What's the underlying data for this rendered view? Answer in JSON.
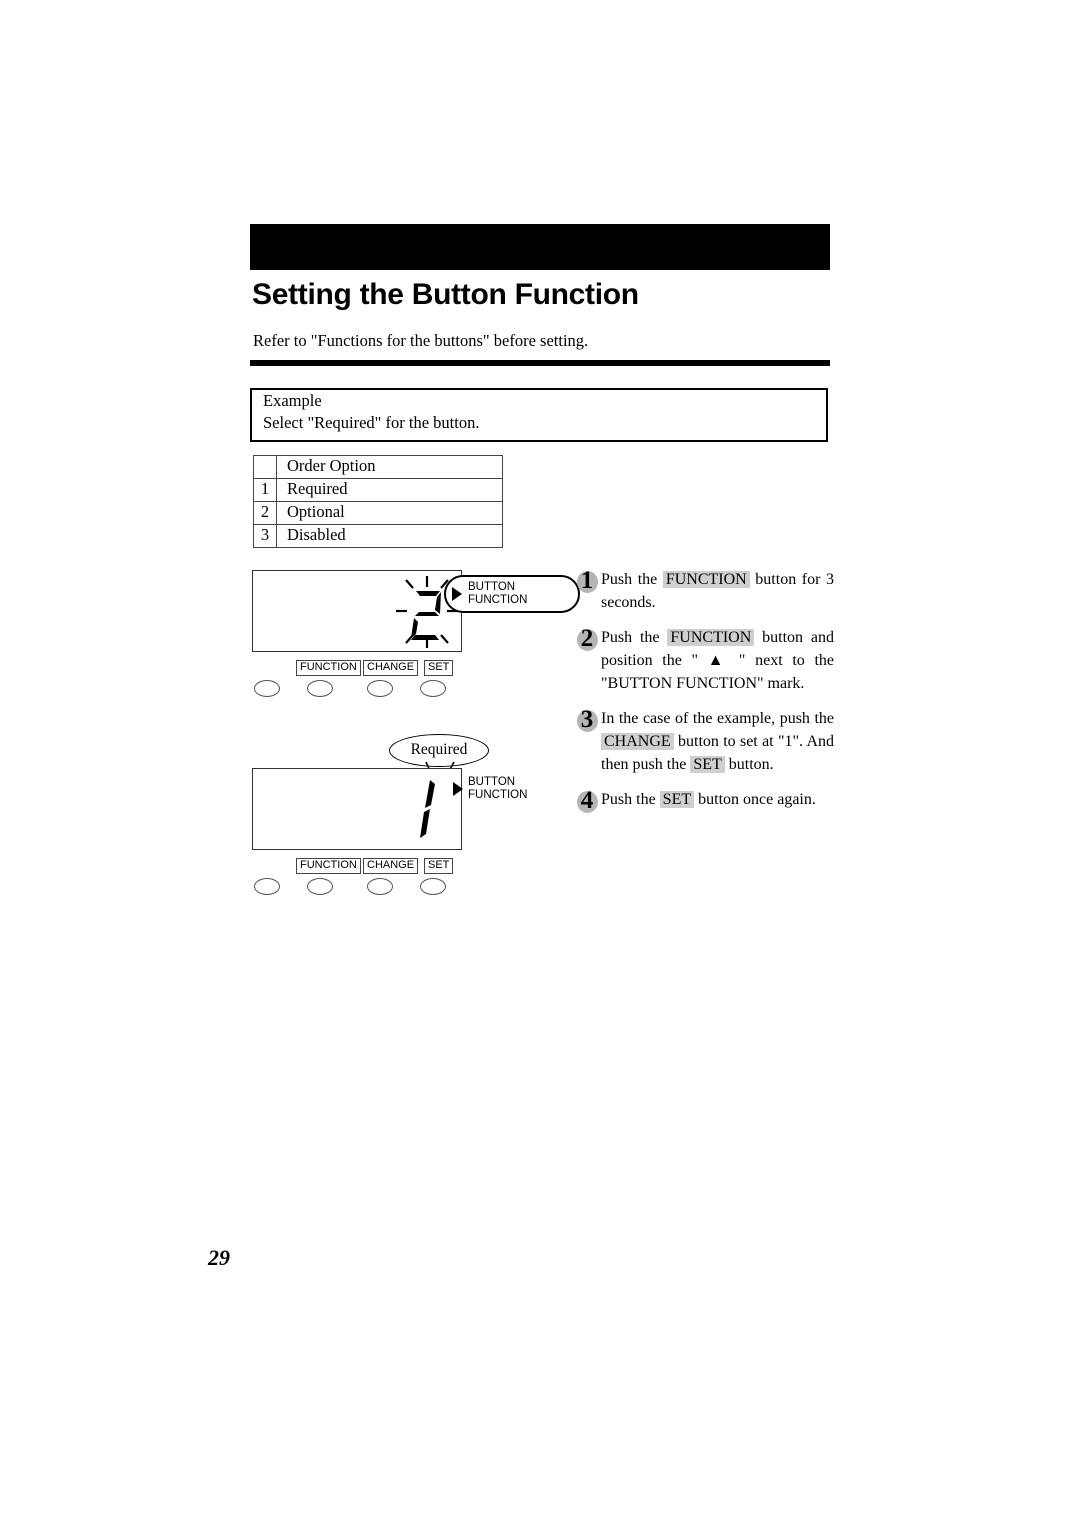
{
  "header": {
    "title": "Setting the Button Function",
    "intro": "Refer to \"Functions for the buttons\" before setting."
  },
  "example": {
    "label": "Example",
    "sentence": "Select \"Required\" for the button."
  },
  "option_table": {
    "columns": [
      "",
      "Order Option"
    ],
    "rows": [
      {
        "num": "1",
        "option": "Required"
      },
      {
        "num": "2",
        "option": "Optional"
      },
      {
        "num": "3",
        "option": "Disabled"
      }
    ]
  },
  "devices": [
    {
      "name": "device-panel-step2",
      "display_digit": "2",
      "display_blinking": true,
      "marker_label_line1": "BUTTON",
      "marker_label_line2": "FUNCTION",
      "marker_highlighted": true,
      "buttons": [
        "FUNCTION",
        "CHANGE",
        "SET"
      ]
    },
    {
      "name": "device-panel-step3",
      "display_digit": "1",
      "display_blinking": false,
      "callout": "Required",
      "marker_label_line1": "BUTTON",
      "marker_label_line2": "FUNCTION",
      "marker_highlighted": false,
      "buttons": [
        "FUNCTION",
        "CHANGE",
        "SET"
      ]
    }
  ],
  "steps": [
    {
      "number": "1",
      "parts": [
        {
          "t": "Push the "
        },
        {
          "t": "FUNCTION",
          "k": true
        },
        {
          "t": " button for 3 seconds."
        }
      ]
    },
    {
      "number": "2",
      "parts": [
        {
          "t": "Push the "
        },
        {
          "t": "FUNCTION",
          "k": true
        },
        {
          "t": " button and position the \" ▲ \" next to the \"BUTTON FUNCTION\" mark."
        }
      ]
    },
    {
      "number": "3",
      "parts": [
        {
          "t": "In the case of the example, push the "
        },
        {
          "t": "CHANGE",
          "k": true
        },
        {
          "t": " button to set at \"1\". And then push the "
        },
        {
          "t": "SET",
          "k": true
        },
        {
          "t": " button."
        }
      ]
    },
    {
      "number": "4",
      "parts": [
        {
          "t": "Push the "
        },
        {
          "t": "SET",
          "k": true
        },
        {
          "t": " button once again."
        }
      ]
    }
  ],
  "page_number": "29",
  "colors": {
    "header_bar": "#000000",
    "keyword_highlight": "#cfcfcf",
    "step_badge": "#b5b5b5"
  }
}
